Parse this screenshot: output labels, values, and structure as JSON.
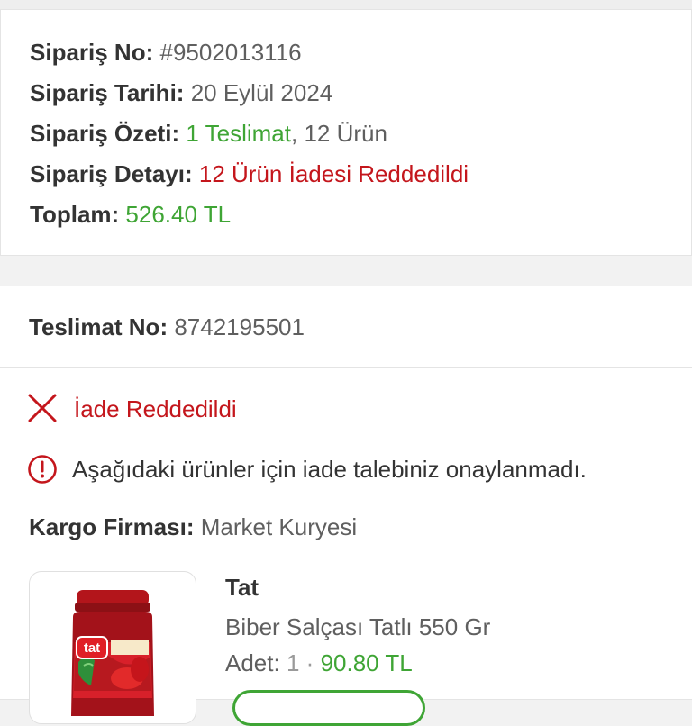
{
  "order": {
    "number_label": "Sipariş No:",
    "number_value": "#9502013116",
    "date_label": "Sipariş Tarihi:",
    "date_value": "20 Eylül 2024",
    "summary_label": "Sipariş Özeti:",
    "summary_delivery": "1 Teslimat",
    "summary_sep": ",",
    "summary_items": "12 Ürün",
    "detail_label": "Sipariş Detayı:",
    "detail_value": "12 Ürün İadesi Reddedildi",
    "total_label": "Toplam:",
    "total_value": "526.40 TL"
  },
  "delivery": {
    "number_label": "Teslimat No:",
    "number_value": "8742195501",
    "status_text": "İade Reddedildi",
    "info_text": "Aşağıdaki ürünler için iade talebiniz onaylanmadı.",
    "carrier_label": "Kargo Firması:",
    "carrier_value": "Market Kuryesi"
  },
  "product": {
    "brand": "Tat",
    "name": "Biber Salçası Tatlı 550 Gr",
    "qty_label": "Adet:",
    "qty_value": "1",
    "dot": "·",
    "price": "90.80 TL",
    "jar_logo_text": "tat"
  },
  "colors": {
    "accent_green": "#3fa535",
    "error_red": "#c4161c"
  },
  "icons": {
    "reject": "close-x-icon",
    "info": "info-circle-icon"
  }
}
